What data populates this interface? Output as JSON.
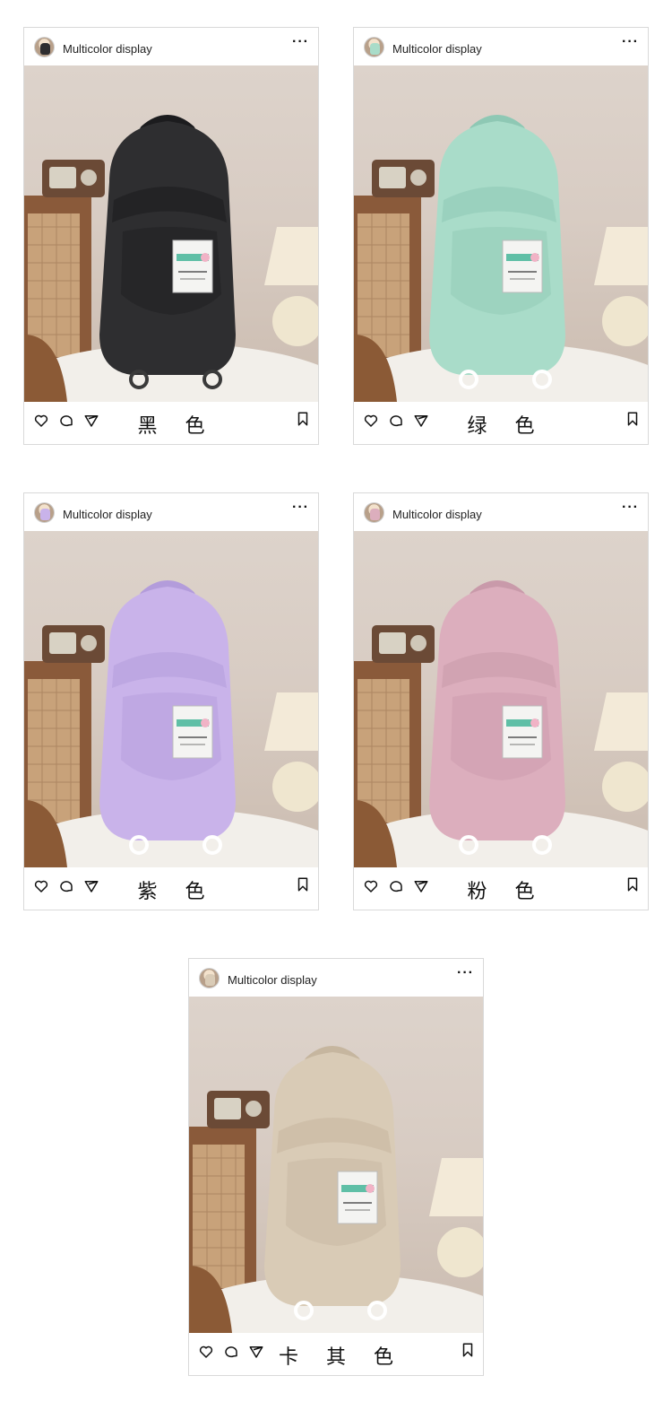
{
  "cards": [
    {
      "username": "Multicolor display",
      "more": "···",
      "color_name": "黑 色",
      "bag_color": "#2e2e30",
      "bag_shade": "#1c1c1e",
      "loop_color": "#3a3a3a"
    },
    {
      "username": "Multicolor display",
      "more": "···",
      "color_name": "绿 色",
      "bag_color": "#a9dcc9",
      "bag_shade": "#8ec8b4",
      "loop_color": "#ffffff"
    },
    {
      "username": "Multicolor display",
      "more": "···",
      "color_name": "紫 色",
      "bag_color": "#c9b3ea",
      "bag_shade": "#b39cdb",
      "loop_color": "#ffffff"
    },
    {
      "username": "Multicolor display",
      "more": "···",
      "color_name": "粉 色",
      "bag_color": "#dcaebd",
      "bag_shade": "#c99aaa",
      "loop_color": "#ffffff"
    },
    {
      "username": "Multicolor display",
      "more": "···",
      "color_name": "卡 其 色",
      "bag_color": "#d9cbb6",
      "bag_shade": "#c6b69f",
      "loop_color": "#ffffff"
    }
  ],
  "icons": {
    "like": "heart-icon",
    "comment": "comment-icon",
    "share": "share-icon",
    "save": "bookmark-icon",
    "more": "more-icon"
  }
}
